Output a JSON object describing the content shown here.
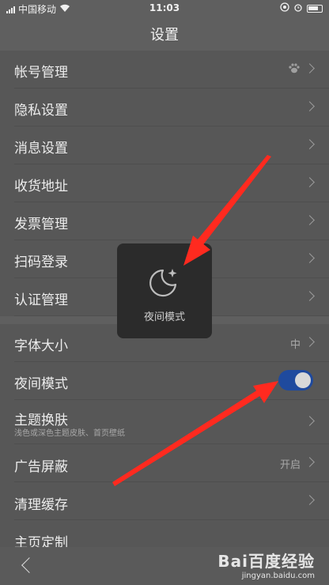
{
  "status_bar": {
    "carrier": "中国移动",
    "time": "11:03"
  },
  "nav": {
    "title": "设置"
  },
  "settings": {
    "account": {
      "label": "帐号管理"
    },
    "privacy": {
      "label": "隐私设置"
    },
    "messages": {
      "label": "消息设置"
    },
    "address": {
      "label": "收货地址"
    },
    "invoice": {
      "label": "发票管理"
    },
    "scan_login": {
      "label": "扫码登录"
    },
    "verification": {
      "label": "认证管理"
    },
    "font_size": {
      "label": "字体大小",
      "value": "中"
    },
    "night_mode": {
      "label": "夜间模式",
      "enabled": true
    },
    "theme": {
      "label": "主题换肤",
      "subtitle": "浅色或深色主题皮肤、首页壁纸"
    },
    "ad_block": {
      "label": "广告屏蔽",
      "value": "开启"
    },
    "clear_cache": {
      "label": "清理缓存"
    },
    "next_partial": {
      "label": "主页定制"
    }
  },
  "toast": {
    "text": "夜间模式"
  },
  "watermark": {
    "brand": "Bai百度经验",
    "url": "jingyan.baidu.com"
  },
  "colors": {
    "toggle_on": "#1f4a9e",
    "annotation_arrow": "#ff2a1f",
    "toast_bg": "#2b2b2b"
  }
}
